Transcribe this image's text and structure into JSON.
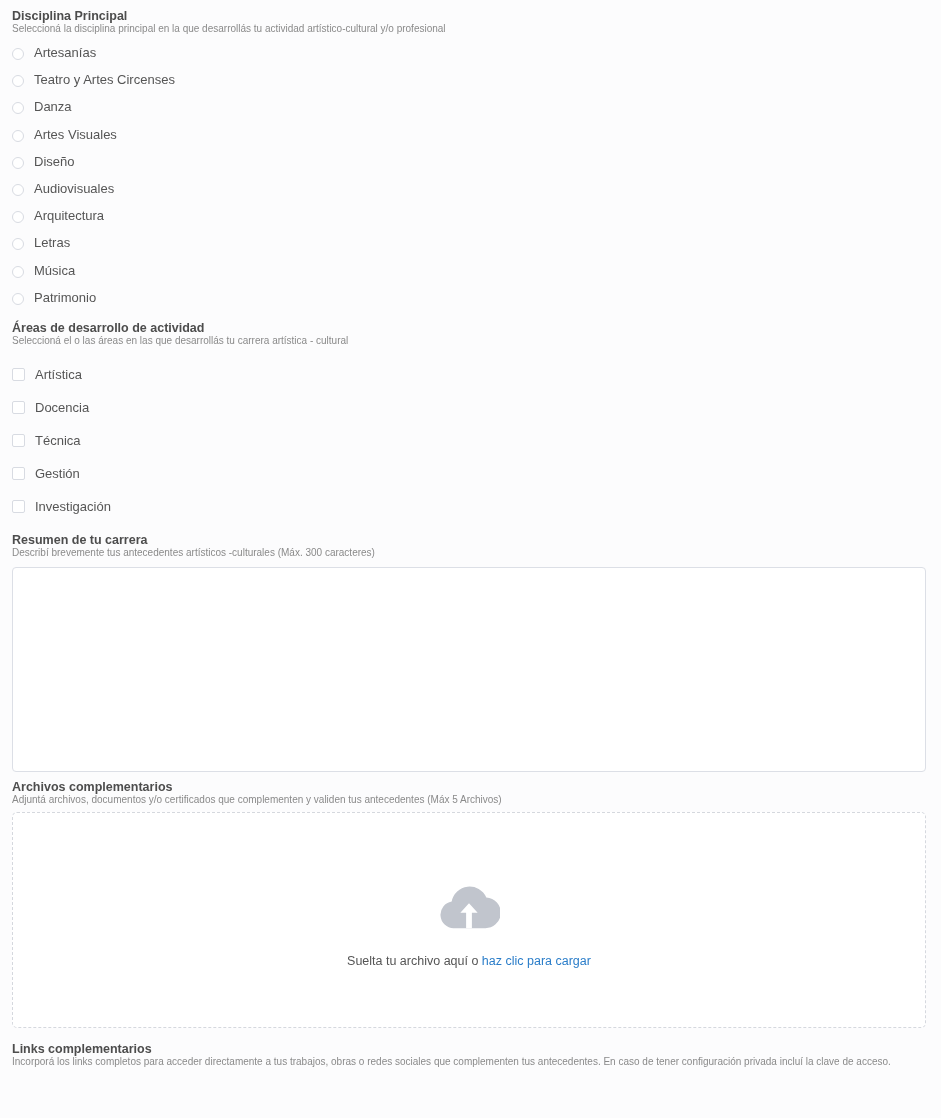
{
  "sections": [
    {
      "kind": "radio",
      "title": "Disciplina Principal",
      "subtitle": "Seleccioná la disciplina principal en la que desarrollás tu actividad artístico-cultural y/o profesional",
      "options": [
        {
          "label": "Artesanías",
          "selected": false
        },
        {
          "label": "Teatro y Artes Circenses",
          "selected": false
        },
        {
          "label": "Danza",
          "selected": false
        },
        {
          "label": "Artes Visuales",
          "selected": false
        },
        {
          "label": "Diseño",
          "selected": false
        },
        {
          "label": "Audiovisuales",
          "selected": false
        },
        {
          "label": "Arquitectura",
          "selected": false
        },
        {
          "label": "Letras",
          "selected": false
        },
        {
          "label": "Música",
          "selected": false
        },
        {
          "label": "Patrimonio",
          "selected": false
        }
      ]
    },
    {
      "kind": "checkbox",
      "title": "Áreas de desarrollo de actividad",
      "subtitle": "Seleccioná el o las áreas en las que desarrollás tu carrera artística - cultural",
      "options": [
        {
          "label": "Artística",
          "checked": false
        },
        {
          "label": "Docencia",
          "checked": false
        },
        {
          "label": "Técnica",
          "checked": false
        },
        {
          "label": "Gestión",
          "checked": false
        },
        {
          "label": "Investigación",
          "checked": false
        }
      ]
    },
    {
      "kind": "textarea",
      "title": "Resumen de tu carrera",
      "subtitle": "Describí brevemente tus antecedentes artísticos -culturales (Máx. 300 caracteres)"
    },
    {
      "kind": "upload",
      "title": "Archivos complementarios",
      "subtitle": "Adjuntá archivos, documentos y/o certificados que complementen y validen tus antecedentes (Máx 5 Archivos)",
      "drop_text": "Suelta tu archivo aquí o",
      "drop_link": "haz clic para cargar"
    },
    {
      "kind": "links",
      "title": "Links complementarios",
      "subtitle": "Incorporá los links completos para acceder directamente a tus trabajos, obras o redes sociales que complementen tus antecedentes. En caso de tener configuración privada incluí la clave de acceso."
    }
  ]
}
